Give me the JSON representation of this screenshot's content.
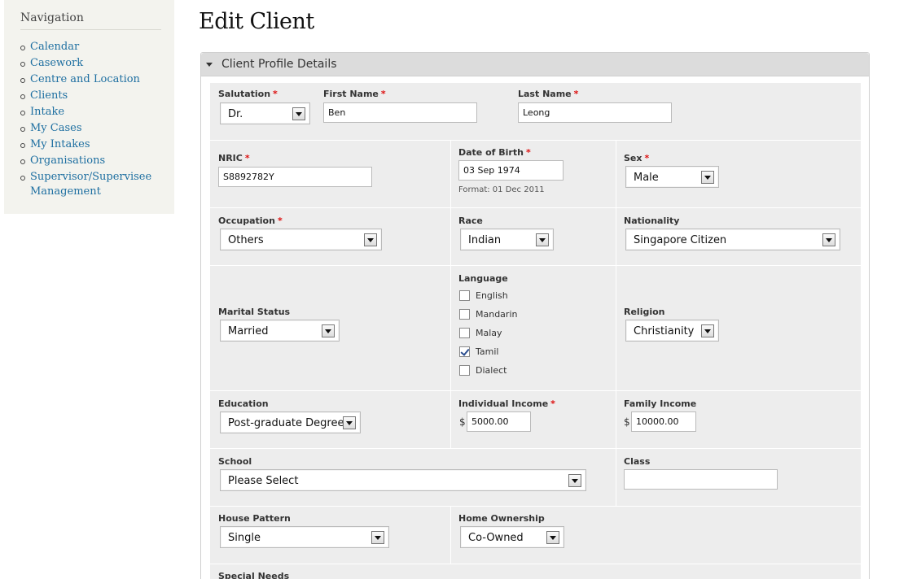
{
  "nav": {
    "title": "Navigation",
    "items": [
      {
        "label": "Calendar"
      },
      {
        "label": "Casework"
      },
      {
        "label": "Centre and Location"
      },
      {
        "label": "Clients"
      },
      {
        "label": "Intake"
      },
      {
        "label": "My Cases"
      },
      {
        "label": "My Intakes"
      },
      {
        "label": "Organisations"
      },
      {
        "label": "Supervisor/Supervisee Management"
      }
    ]
  },
  "page": {
    "title": "Edit Client"
  },
  "fieldset": {
    "legend": "Client Profile Details"
  },
  "form": {
    "salutation": {
      "label": "Salutation",
      "value": "Dr."
    },
    "first_name": {
      "label": "First Name",
      "value": "Ben"
    },
    "last_name": {
      "label": "Last Name",
      "value": "Leong"
    },
    "nric": {
      "label": "NRIC",
      "value": "S8892782Y"
    },
    "dob": {
      "label": "Date of Birth",
      "value": "03 Sep 1974",
      "hint": "Format: 01 Dec 2011"
    },
    "sex": {
      "label": "Sex",
      "value": "Male"
    },
    "occupation": {
      "label": "Occupation",
      "value": "Others"
    },
    "race": {
      "label": "Race",
      "value": "Indian"
    },
    "nationality": {
      "label": "Nationality",
      "value": "Singapore Citizen"
    },
    "marital_status": {
      "label": "Marital Status",
      "value": "Married"
    },
    "language": {
      "label": "Language",
      "options": [
        {
          "label": "English",
          "checked": false
        },
        {
          "label": "Mandarin",
          "checked": false
        },
        {
          "label": "Malay",
          "checked": false
        },
        {
          "label": "Tamil",
          "checked": true
        },
        {
          "label": "Dialect",
          "checked": false
        }
      ]
    },
    "religion": {
      "label": "Religion",
      "value": "Christianity"
    },
    "education": {
      "label": "Education",
      "value": "Post-graduate Degree"
    },
    "individual_income": {
      "label": "Individual Income",
      "currency": "$",
      "value": "5000.00"
    },
    "family_income": {
      "label": "Family Income",
      "currency": "$",
      "value": "10000.00"
    },
    "school": {
      "label": "School",
      "value": "Please Select"
    },
    "class": {
      "label": "Class",
      "value": ""
    },
    "house_pattern": {
      "label": "House Pattern",
      "value": "Single"
    },
    "home_ownership": {
      "label": "Home Ownership",
      "value": "Co-Owned"
    },
    "special_needs": {
      "label": "Special Needs"
    },
    "required_marker": "*"
  },
  "colors": {
    "link": "#1e6fa1",
    "required": "#dd1111",
    "row_bg": "#ededed",
    "legend_bg": "#dcdcdc"
  }
}
